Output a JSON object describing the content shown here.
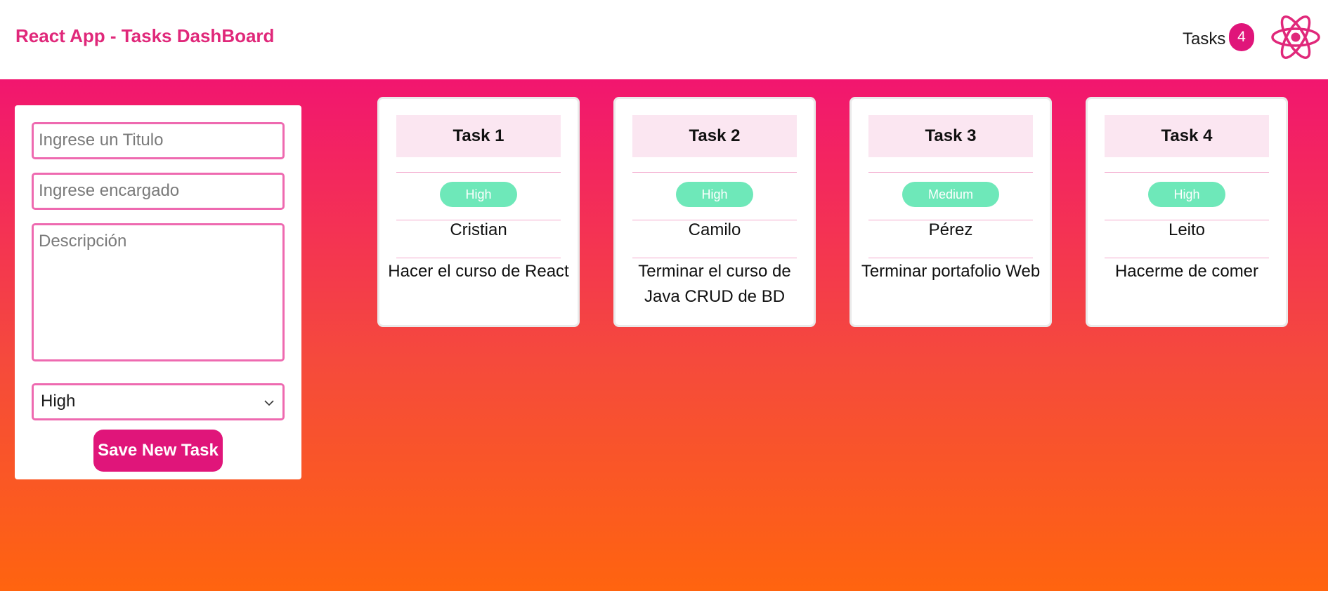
{
  "header": {
    "title": "React App - Tasks DashBoard",
    "tasks_label": "Tasks",
    "tasks_count": "4",
    "logo_icon": "react-atom-icon"
  },
  "form": {
    "title_placeholder": "Ingrese un Titulo",
    "responsible_placeholder": "Ingrese encargado",
    "description_placeholder": "Descripción",
    "priority_selected": "High",
    "save_label": "Save New Task"
  },
  "tasks": [
    {
      "title": "Task 1",
      "priority": "High",
      "responsible": "Cristian",
      "description": "Hacer el curso de React"
    },
    {
      "title": "Task 2",
      "priority": "High",
      "responsible": "Camilo",
      "description": "Terminar el curso de Java CRUD de BD"
    },
    {
      "title": "Task 3",
      "priority": "Medium",
      "responsible": "Pérez",
      "description": "Terminar portafolio Web"
    },
    {
      "title": "Task 4",
      "priority": "High",
      "responsible": "Leito",
      "description": "Hacerme de comer"
    }
  ],
  "colors": {
    "accent": "#e0157a",
    "badge_green": "#6ee8b9",
    "gradient_top": "#f2166f",
    "gradient_bottom": "#ff640f"
  }
}
